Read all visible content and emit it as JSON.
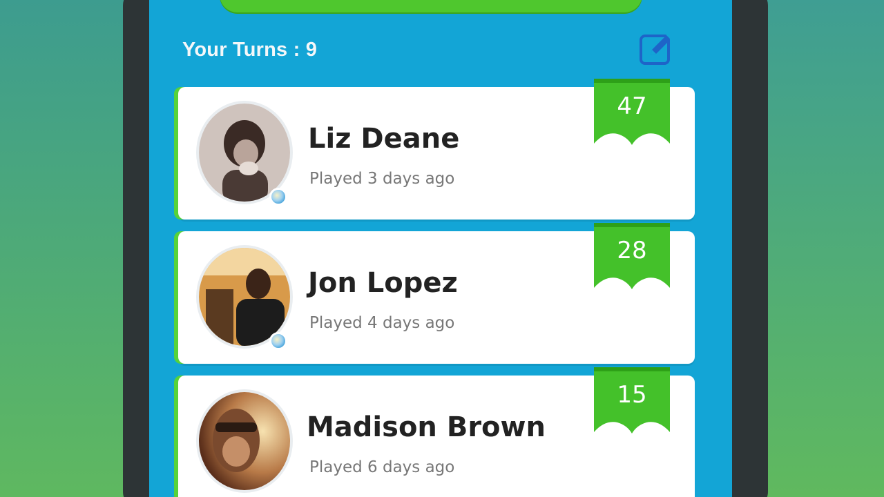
{
  "header": {
    "turns_label": "Your Turns : 9"
  },
  "icons": {
    "edit": "edit-icon"
  },
  "colors": {
    "screen_bg": "#13a5d6",
    "accent_green": "#4fc72e",
    "card_bg": "#ffffff"
  },
  "games": [
    {
      "name": "Liz Deane",
      "played": "Played 3 days ago",
      "score": "47"
    },
    {
      "name": "Jon Lopez",
      "played": "Played 4 days ago",
      "score": "28"
    },
    {
      "name": "Madison Brown",
      "played": "Played 6 days ago",
      "score": "15"
    }
  ]
}
